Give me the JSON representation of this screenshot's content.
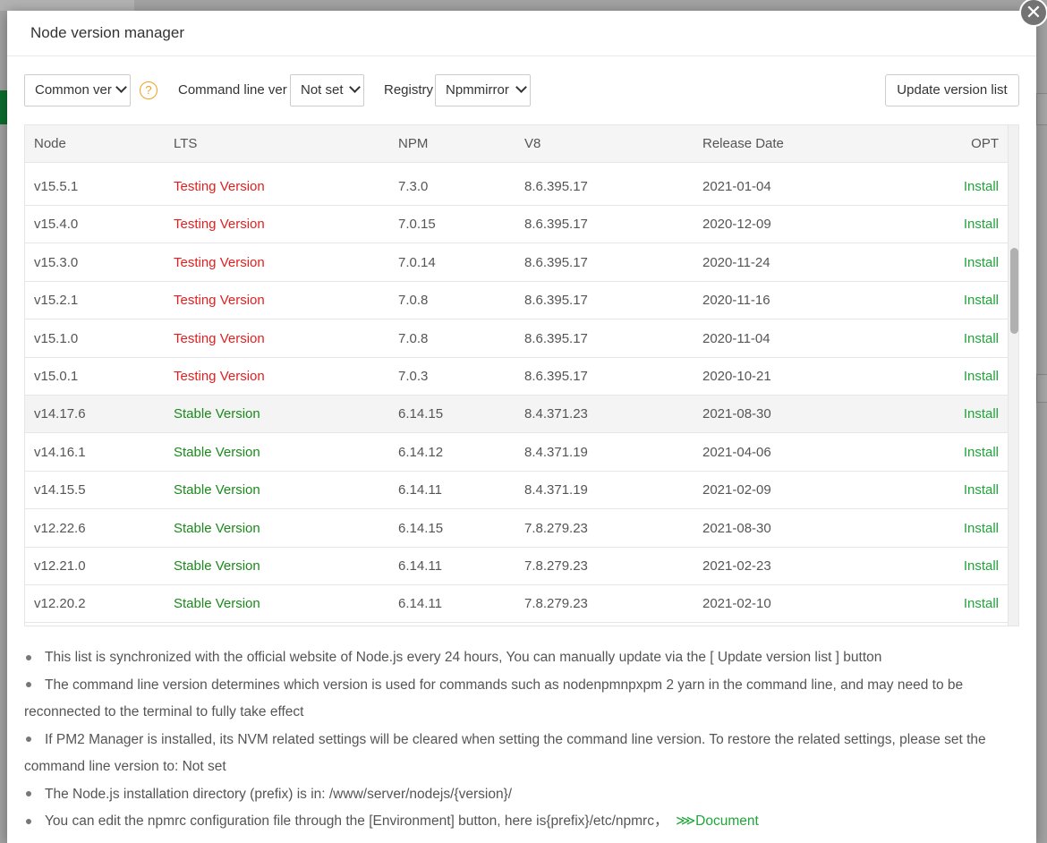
{
  "modal": {
    "title": "Node version manager",
    "close_glyph": "✕"
  },
  "toolbar": {
    "version_filter": "Common ver",
    "help_glyph": "?",
    "command_line_label": "Command line ver",
    "command_line_value": "Not set",
    "registry_label": "Registry",
    "registry_value": "Npmmirror",
    "update_button": "Update version list"
  },
  "table": {
    "headers": [
      "Node",
      "LTS",
      "NPM",
      "V8",
      "Release Date",
      "OPT"
    ],
    "rows": [
      {
        "node": "v15.5.1",
        "lts": "Testing Version",
        "npm": "7.3.0",
        "v8": "8.6.395.17",
        "date": "2021-01-04",
        "opt": "Install"
      },
      {
        "node": "v15.4.0",
        "lts": "Testing Version",
        "npm": "7.0.15",
        "v8": "8.6.395.17",
        "date": "2020-12-09",
        "opt": "Install"
      },
      {
        "node": "v15.3.0",
        "lts": "Testing Version",
        "npm": "7.0.14",
        "v8": "8.6.395.17",
        "date": "2020-11-24",
        "opt": "Install"
      },
      {
        "node": "v15.2.1",
        "lts": "Testing Version",
        "npm": "7.0.8",
        "v8": "8.6.395.17",
        "date": "2020-11-16",
        "opt": "Install"
      },
      {
        "node": "v15.1.0",
        "lts": "Testing Version",
        "npm": "7.0.8",
        "v8": "8.6.395.17",
        "date": "2020-11-04",
        "opt": "Install"
      },
      {
        "node": "v15.0.1",
        "lts": "Testing Version",
        "npm": "7.0.3",
        "v8": "8.6.395.17",
        "date": "2020-10-21",
        "opt": "Install"
      },
      {
        "node": "v14.17.6",
        "lts": "Stable Version",
        "npm": "6.14.15",
        "v8": "8.4.371.23",
        "date": "2021-08-30",
        "opt": "Install"
      },
      {
        "node": "v14.16.1",
        "lts": "Stable Version",
        "npm": "6.14.12",
        "v8": "8.4.371.19",
        "date": "2021-04-06",
        "opt": "Install"
      },
      {
        "node": "v14.15.5",
        "lts": "Stable Version",
        "npm": "6.14.11",
        "v8": "8.4.371.19",
        "date": "2021-02-09",
        "opt": "Install"
      },
      {
        "node": "v12.22.6",
        "lts": "Stable Version",
        "npm": "6.14.15",
        "v8": "7.8.279.23",
        "date": "2021-08-30",
        "opt": "Install"
      },
      {
        "node": "v12.21.0",
        "lts": "Stable Version",
        "npm": "6.14.11",
        "v8": "7.8.279.23",
        "date": "2021-02-23",
        "opt": "Install"
      },
      {
        "node": "v12.20.2",
        "lts": "Stable Version",
        "npm": "6.14.11",
        "v8": "7.8.279.23",
        "date": "2021-02-10",
        "opt": "Install"
      }
    ]
  },
  "notes": {
    "n1": "This list is synchronized with the official website of Node.js every 24 hours, You can manually update via the [ Update version list ] button",
    "n2": "The command line version determines which version is used for commands such as nodenpmnpxpm 2 yarn in the command line, and may need to be reconnected to the terminal to fully take effect",
    "n3": "If PM2 Manager is installed, its NVM related settings will be cleared when setting the command line version. To restore the related settings, please set the command line version to: Not set",
    "n4": "The Node.js installation directory (prefix) is in: /www/server/nodejs/{version}/",
    "n5": "You can edit the npmrc configuration file through the [Environment] button, here is{prefix}/etc/npmrc，",
    "doc_link": "⋙Document"
  },
  "colors": {
    "testing": "#e02020",
    "stable": "#1a8a1a",
    "install": "#20a53a",
    "help": "#f0a020"
  }
}
